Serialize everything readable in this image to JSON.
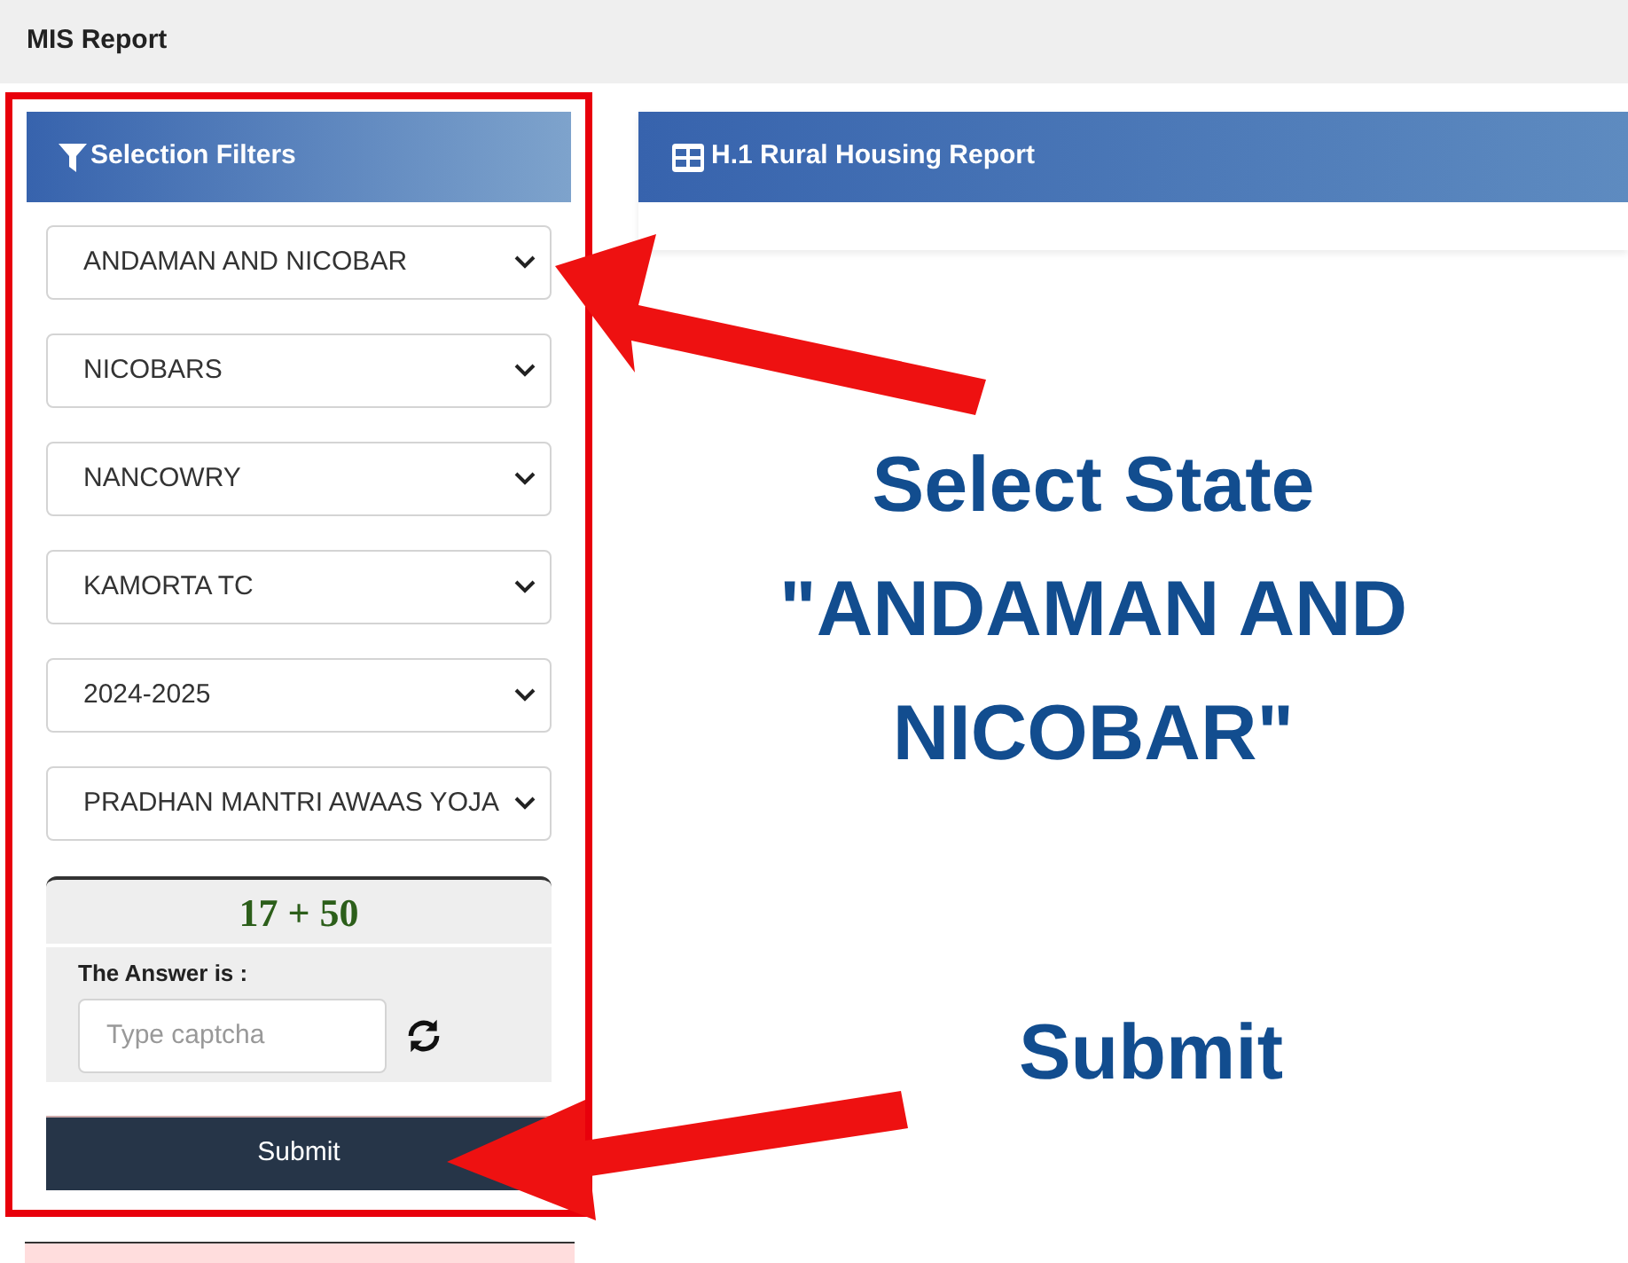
{
  "header": {
    "title": "MIS Report"
  },
  "filters": {
    "title": "Selection Filters",
    "selects": [
      {
        "value": "ANDAMAN AND NICOBAR"
      },
      {
        "value": "NICOBARS"
      },
      {
        "value": "NANCOWRY"
      },
      {
        "value": "KAMORTA TC"
      },
      {
        "value": "2024-2025"
      },
      {
        "value": "PRADHAN MANTRI AWAAS YOJA"
      }
    ],
    "captcha": {
      "expression": "17 + 50",
      "label": "The Answer is :",
      "placeholder": "Type captcha"
    },
    "submit": "Submit"
  },
  "report": {
    "title": "H.1 Rural Housing Report"
  },
  "annotations": [
    {
      "lines": [
        "Select State",
        "\"ANDAMAN AND",
        "NICOBAR\""
      ]
    },
    {
      "lines": [
        "Submit"
      ]
    }
  ]
}
